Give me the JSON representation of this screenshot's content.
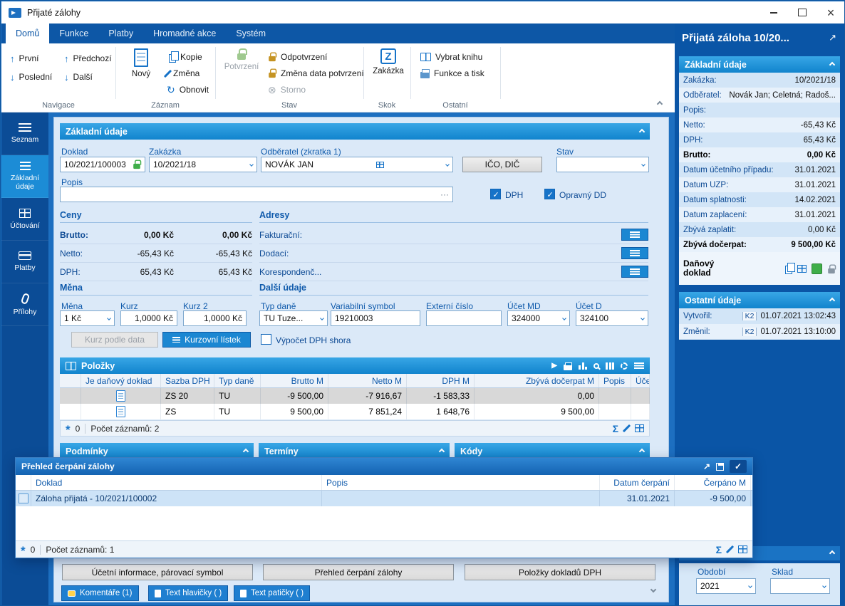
{
  "window": {
    "title": "Přijaté zálohy"
  },
  "ribbon": {
    "tabs": [
      {
        "label": "Domů"
      },
      {
        "label": "Funkce"
      },
      {
        "label": "Platby"
      },
      {
        "label": "Hromadné akce"
      },
      {
        "label": "Systém"
      }
    ],
    "groups": {
      "navigace": {
        "label": "Navigace",
        "prvni": "První",
        "posledni": "Poslední",
        "predchozi": "Předchozí",
        "dalsi": "Další"
      },
      "zaznam": {
        "label": "Záznam",
        "novy": "Nový",
        "kopie": "Kopie",
        "zmena": "Změna",
        "obnovit": "Obnovit"
      },
      "stav": {
        "label": "Stav",
        "potvrzeni": "Potvrzení",
        "odpotvrzeni": "Odpotvrzení",
        "zmena_data": "Změna data potvrzení",
        "storno": "Storno"
      },
      "skok": {
        "label": "Skok",
        "zakazka": "Zakázka"
      },
      "ostatni": {
        "label": "Ostatní",
        "vybrat_knihu": "Vybrat knihu",
        "funkce_tisk": "Funkce a tisk"
      }
    }
  },
  "sidebar": {
    "items": [
      {
        "label": "Seznam"
      },
      {
        "label": "Základní údaje"
      },
      {
        "label": "Účtování"
      },
      {
        "label": "Platby"
      },
      {
        "label": "Přílohy"
      }
    ]
  },
  "form": {
    "section_title": "Základní údaje",
    "doklad_label": "Doklad",
    "doklad_value": "10/2021/100003",
    "zakazka_label": "Zakázka",
    "zakazka_value": "10/2021/18",
    "odberatel_label": "Odběratel (zkratka 1)",
    "odberatel_value": "NOVÁK JAN",
    "ico_dic_button": "IČO, DIČ",
    "stav_label": "Stav",
    "stav_value": "",
    "popis_label": "Popis",
    "popis_value": "",
    "dph_checkbox": "DPH",
    "opravny_dd_checkbox": "Opravný DD",
    "ceny": {
      "title": "Ceny",
      "rows": [
        {
          "label": "Brutto:",
          "v1": "0,00 Kč",
          "v2": "0,00 Kč"
        },
        {
          "label": "Netto:",
          "v1": "-65,43 Kč",
          "v2": "-65,43 Kč"
        },
        {
          "label": "DPH:",
          "v1": "65,43 Kč",
          "v2": "65,43 Kč"
        }
      ]
    },
    "adresy": {
      "title": "Adresy",
      "rows": [
        {
          "label": "Fakturační:"
        },
        {
          "label": "Dodací:"
        },
        {
          "label": "Korespondenč..."
        }
      ]
    },
    "mena": {
      "title": "Měna",
      "mena_label": "Měna",
      "mena_value": "1 Kč",
      "kurz_label": "Kurz",
      "kurz_value": "1,0000 Kč",
      "kurz2_label": "Kurz 2",
      "kurz2_value": "1,0000 Kč"
    },
    "dalsi": {
      "title": "Další údaje",
      "typ_dane_label": "Typ daně",
      "typ_dane_value": "TU Tuze...",
      "var_symbol_label": "Variabilní symbol",
      "var_symbol_value": "19210003",
      "externi_cislo_label": "Externí číslo",
      "externi_cislo_value": "",
      "ucet_md_label": "Účet MD",
      "ucet_md_value": "324000",
      "ucet_d_label": "Účet D",
      "ucet_d_value": "324100"
    },
    "kurz_podle_data_button": "Kurz podle data",
    "kurzovni_listek_button": "Kurzovní lístek",
    "vypocet_dph_checkbox": "Výpočet DPH shora"
  },
  "polozky": {
    "title": "Položky",
    "columns": {
      "je_danovy": "Je daňový doklad",
      "sazba": "Sazba DPH",
      "typ_dane": "Typ daně",
      "brutto": "Brutto M",
      "netto": "Netto M",
      "dph": "DPH M",
      "zbyva": "Zbývá dočerpat M",
      "popis": "Popis",
      "ucet": "Účet"
    },
    "rows": [
      {
        "sazba": "ZS 20",
        "typ": "TU",
        "brutto": "-9 500,00",
        "netto": "-7 916,67",
        "dph": "-1 583,33",
        "zbyva": "0,00"
      },
      {
        "sazba": "ZS",
        "typ": "TU",
        "brutto": "9 500,00",
        "netto": "7 851,24",
        "dph": "1 648,76",
        "zbyva": "9 500,00"
      }
    ],
    "counter": "0",
    "count_label": "Počet záznamů: 2"
  },
  "sections": {
    "podminky": "Podmínky",
    "terminy": "Termíny",
    "kody": "Kódy"
  },
  "modal": {
    "title": "Přehled čerpání zálohy",
    "columns": {
      "doklad": "Doklad",
      "popis": "Popis",
      "datum": "Datum čerpání",
      "cerpano": "Čerpáno M"
    },
    "rows": [
      {
        "doklad": "Záloha přijatá - 10/2021/100002",
        "popis": "",
        "datum": "31.01.2021",
        "cerpano": "-9 500,00"
      }
    ],
    "counter": "0",
    "count_label": "Počet záznamů: 1"
  },
  "bottom": {
    "buttons": [
      {
        "label": "Účetní informace, párovací symbol"
      },
      {
        "label": "Přehled čerpání zálohy"
      },
      {
        "label": "Položky dokladů DPH"
      }
    ],
    "tabs": [
      {
        "label": "Komentáře (1)"
      },
      {
        "label": "Text hlavičky ( )"
      },
      {
        "label": "Text patičky ( )"
      }
    ]
  },
  "right_panel": {
    "title": "Přijatá záloha 10/20...",
    "zakladni": {
      "title": "Základní údaje",
      "rows": [
        {
          "label": "Zakázka:",
          "value": "10/2021/18"
        },
        {
          "label": "Odběratel:",
          "value": "Novák Jan; Celetná; Radoš..."
        },
        {
          "label": "Popis:",
          "value": ""
        },
        {
          "label": "Netto:",
          "value": "-65,43 Kč"
        },
        {
          "label": "DPH:",
          "value": "65,43 Kč"
        },
        {
          "label": "Brutto:",
          "value": "0,00 Kč"
        },
        {
          "label": "Datum účetního případu:",
          "value": "31.01.2021"
        },
        {
          "label": "Datum UZP:",
          "value": "31.01.2021"
        },
        {
          "label": "Datum splatnosti:",
          "value": "14.02.2021"
        },
        {
          "label": "Datum zaplacení:",
          "value": "31.01.2021"
        },
        {
          "label": "Zbývá zaplatit:",
          "value": "0,00 Kč"
        },
        {
          "label": "Zbývá dočerpat:",
          "value": "9 500,00 Kč"
        }
      ],
      "danovy_doklad_label": "Daňový doklad"
    },
    "ostatni": {
      "title": "Ostatní údaje",
      "rows": [
        {
          "label": "Vytvořil:",
          "user": "K2",
          "value": "01.07.2021 13:02:43"
        },
        {
          "label": "Změnil:",
          "user": "K2",
          "value": "01.07.2021 13:10:00"
        }
      ]
    },
    "obdobi_label": "Období",
    "obdobi_value": "2021",
    "sklad_label": "Sklad",
    "sklad_value": ""
  }
}
